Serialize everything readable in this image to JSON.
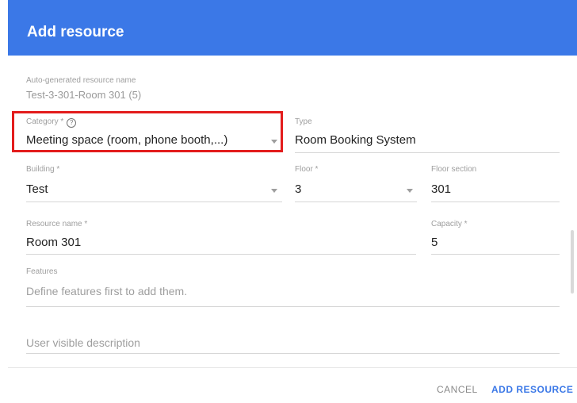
{
  "dialog": {
    "title": "Add resource"
  },
  "auto_name": {
    "label": "Auto-generated resource name",
    "value": "Test-3-301-Room 301 (5)"
  },
  "category": {
    "label": "Category *",
    "value": "Meeting space (room, phone booth,...)"
  },
  "type": {
    "label": "Type",
    "value": "Room Booking System"
  },
  "building": {
    "label": "Building *",
    "value": "Test"
  },
  "floor": {
    "label": "Floor *",
    "value": "3"
  },
  "floor_section": {
    "label": "Floor section",
    "value": "301"
  },
  "resource_name": {
    "label": "Resource name *",
    "value": "Room 301"
  },
  "capacity": {
    "label": "Capacity *",
    "value": "5"
  },
  "features": {
    "label": "Features",
    "placeholder": "Define features first to add them."
  },
  "description": {
    "placeholder": "User visible description"
  },
  "footer": {
    "cancel_label": "CANCEL",
    "add_label": "ADD RESOURCE"
  },
  "colors": {
    "header": "#3b78e7",
    "highlight": "#e31c1c",
    "primary_button": "#3b78e7"
  }
}
